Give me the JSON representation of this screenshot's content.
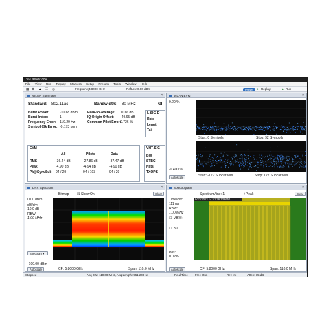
{
  "window": {
    "title": "Tek RSA5100A",
    "menu": [
      "File",
      "View",
      "Run",
      "Replay",
      "Markers",
      "Setup",
      "Presets",
      "Tools",
      "Window",
      "Help"
    ],
    "toolbar": {
      "frequency_label": "Frequency:",
      "frequency_value": "5.8000 GHz",
      "reflev_label": "RefLev:",
      "reflev_value": "0.00 dBm",
      "preset_button": "Preset",
      "replay_button": "Replay",
      "run_button": "Run"
    }
  },
  "wlan_summary": {
    "title": "WLAN Summary",
    "standard_label": "Standard:",
    "standard_value": "802.11ac",
    "bandwidth_label": "Bandwidth:",
    "bandwidth_value": "80 MHz",
    "gi_label": "GI",
    "left_rows": [
      {
        "label": "Burst Power:",
        "value": "-10.68 dBm"
      },
      {
        "label": "Burst Index:",
        "value": "1"
      },
      {
        "label": "Frequency Error:",
        "value": "119.29 Hz"
      },
      {
        "label": "Symbol Clk Error:",
        "value": "-0.173 ppm"
      }
    ],
    "right_rows": [
      {
        "label": "Peak-to-Average:",
        "value": "11.66 dB"
      },
      {
        "label": "IQ Origin Offset:",
        "value": "-49.65 dB"
      },
      {
        "label": "Common Pilot Error:",
        "value": "0.726 %"
      }
    ],
    "side_box_title": "L-SIG D",
    "side_box_rows": [
      "Rate",
      "Lengt",
      "Tail"
    ],
    "evm_title": "EVM",
    "evm_headers": [
      "All",
      "Pilots",
      "Data"
    ],
    "evm_rows": [
      {
        "label": "RMS",
        "values": [
          "-36.44 dB",
          "-27.86 dB",
          "-37.47 dB"
        ]
      },
      {
        "label": "Peak",
        "values": [
          "-4.90 dB",
          "-4.94 dB",
          "-4.90 dB"
        ]
      },
      {
        "label": "Pk@Sym/Sub",
        "values": [
          "94 / 29",
          "94 / 103",
          "94 / 29"
        ]
      }
    ],
    "vht_title": "VHT-SIG",
    "vht_rows": [
      "BW",
      "STBC",
      "Nsts",
      "TXOPS"
    ]
  },
  "wlan_evm": {
    "title": "WLAN EVM",
    "top_y": "9.20 %",
    "bottom_y": "-0.400 %",
    "row1_start": "Start: 0 Symbols",
    "row1_stop": "Stop: 92 Symbols",
    "row2_start": "Start: -122 Subcarriers",
    "row2_stop": "Stop: 122 Subcarriers",
    "autoscale": "Autoscale"
  },
  "dpx": {
    "title": "DPX Spectrum",
    "bitmap_label": "Bitmap",
    "show_label": "Show",
    "on_label": "On",
    "clear_button": "Clear",
    "reflev": "0.00 dBm",
    "db_div_label": "dB/div:",
    "db_div_value": "10.0 dB",
    "rbw_label": "RBW:",
    "rbw_value": "1.00 MHz",
    "bottom_level": "-100.00 dBm",
    "spectrum_select": "Spectrum",
    "autoscale": "Autoscale",
    "cf": "CF: 5.8000 GHz",
    "span": "Span: 110.0 MHz"
  },
  "spectrogram": {
    "title": "Spectrogram",
    "line_label": "Spectrum/line: 1",
    "peak_label": "+Peak",
    "clear_button": "Clear",
    "time_div_label": "Time/div:",
    "time_div_value": "111 us",
    "rbw_label": "RBW:",
    "rbw_value": "1.00 MHz",
    "vbw_label": "VBW:",
    "threed_label": "3-D",
    "pos_label": "Pos:",
    "pos_value": "0.0 div",
    "timestamp": "9/23/2013 14:41:36.738650",
    "autoscale": "Autoscale",
    "cf": "CF: 5.8000 GHz",
    "span": "Span: 110.0 MHz"
  },
  "status": {
    "state": "Stopped",
    "acq_bw": "Acq BW: 110.00 MHz, Acq Length: 951.200 us",
    "real_time": "Real Time",
    "free_run": "Free Run",
    "ref": "Ref: Int",
    "atten": "Atten: 15 dB"
  }
}
